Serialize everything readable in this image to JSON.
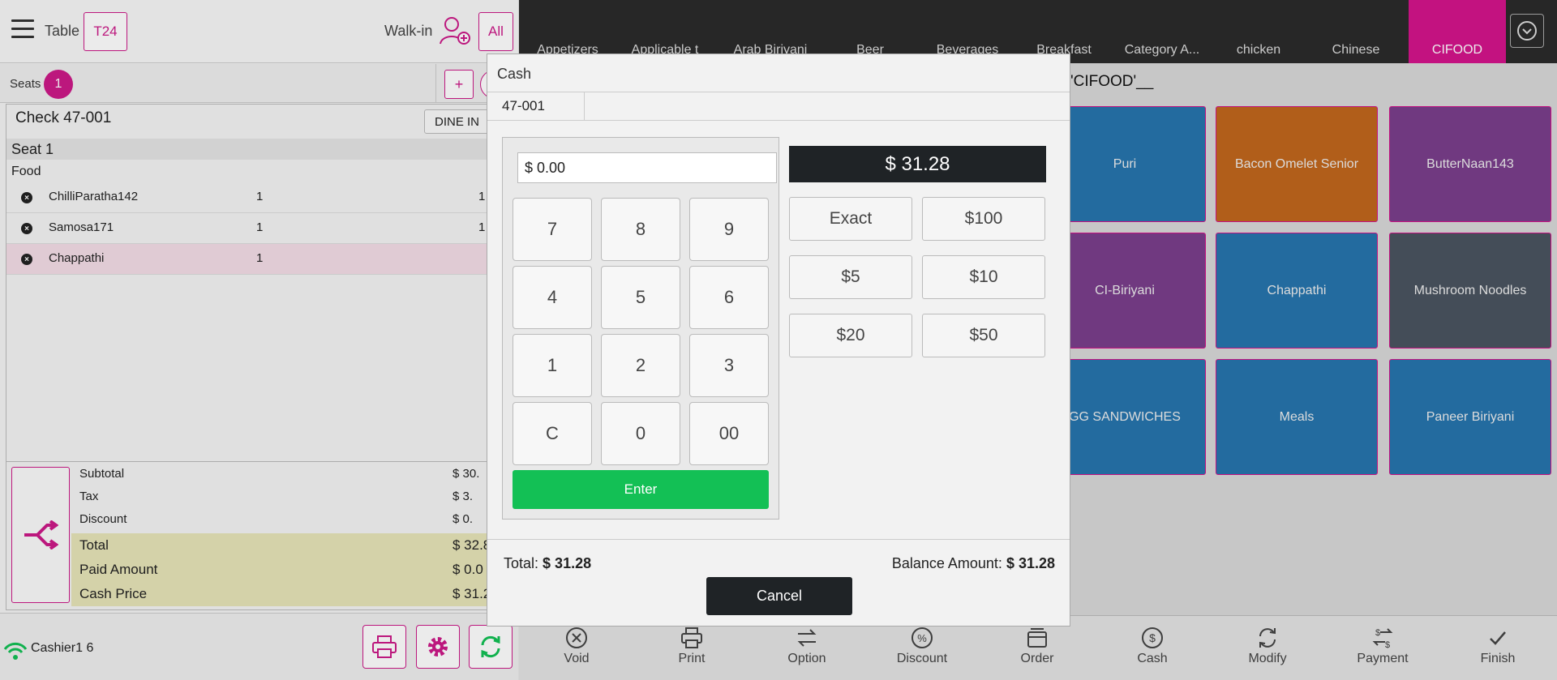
{
  "header": {
    "table_label": "Table",
    "table_value": "T24",
    "walkin_label": "Walk-in",
    "all_label": "All"
  },
  "seats": {
    "label": "Seats",
    "count": "1",
    "plus_label": "+"
  },
  "check": {
    "title": "Check 47-001",
    "order_type": "DINE IN",
    "seat_label": "Seat 1",
    "category": "Food",
    "items": [
      {
        "name": "ChilliParatha142",
        "qty": "1",
        "price": "1"
      },
      {
        "name": "Samosa171",
        "qty": "1",
        "price": "1"
      },
      {
        "name": "Chappathi",
        "qty": "1",
        "price": ""
      }
    ]
  },
  "totals": {
    "subtotal_label": "Subtotal",
    "subtotal": "$ 30.",
    "tax_label": "Tax",
    "tax": "$ 3.",
    "discount_label": "Discount",
    "discount": "$ 0.",
    "total_label": "Total",
    "total": "$ 32.8",
    "paid_label": "Paid Amount",
    "paid": "$ 0.0",
    "cash_label": "Cash Price",
    "cash": "$ 31.2"
  },
  "bottom": {
    "cashier": "Cashier1 6"
  },
  "categories": [
    "Appetizers",
    "Applicable t",
    "Arab Biriyani",
    "Beer",
    "Beverages",
    "Breakfast",
    "Category A...",
    "chicken",
    "Chinese",
    "CIFOOD"
  ],
  "path_label": "'CIFOOD'__",
  "tiles": [
    "Puri",
    "Bacon Omelet Senior",
    "ButterNaan143",
    "CI-Biriyani",
    "Chappathi",
    "Mushroom Noodles",
    "GG SANDWICHES",
    "Meals",
    "Paneer Biriyani"
  ],
  "colors": {
    "accent": "#cc1a88",
    "tile_blue": "#2675ad",
    "tile_orange": "#c1661d",
    "tile_purple": "#7a3e8b",
    "tile_slate": "#4a5460",
    "enter_green": "#13c055"
  },
  "footer": [
    "Void",
    "Print",
    "Option",
    "Discount",
    "Order",
    "Cash",
    "Modify",
    "Payment",
    "Finish"
  ],
  "modal": {
    "title": "Cash",
    "check_no": "47-001",
    "amount_value": "$ 0.00",
    "keys": [
      "7",
      "8",
      "9",
      "4",
      "5",
      "6",
      "1",
      "2",
      "3",
      "C",
      "0",
      "00"
    ],
    "enter_label": "Enter",
    "due": "$ 31.28",
    "quick": [
      "Exact",
      "$100",
      "$5",
      "$10",
      "$20",
      "$50"
    ],
    "total_label": "Total:",
    "total_value": "$ 31.28",
    "balance_label": "Balance Amount:",
    "balance_value": "$ 31.28",
    "cancel_label": "Cancel"
  }
}
